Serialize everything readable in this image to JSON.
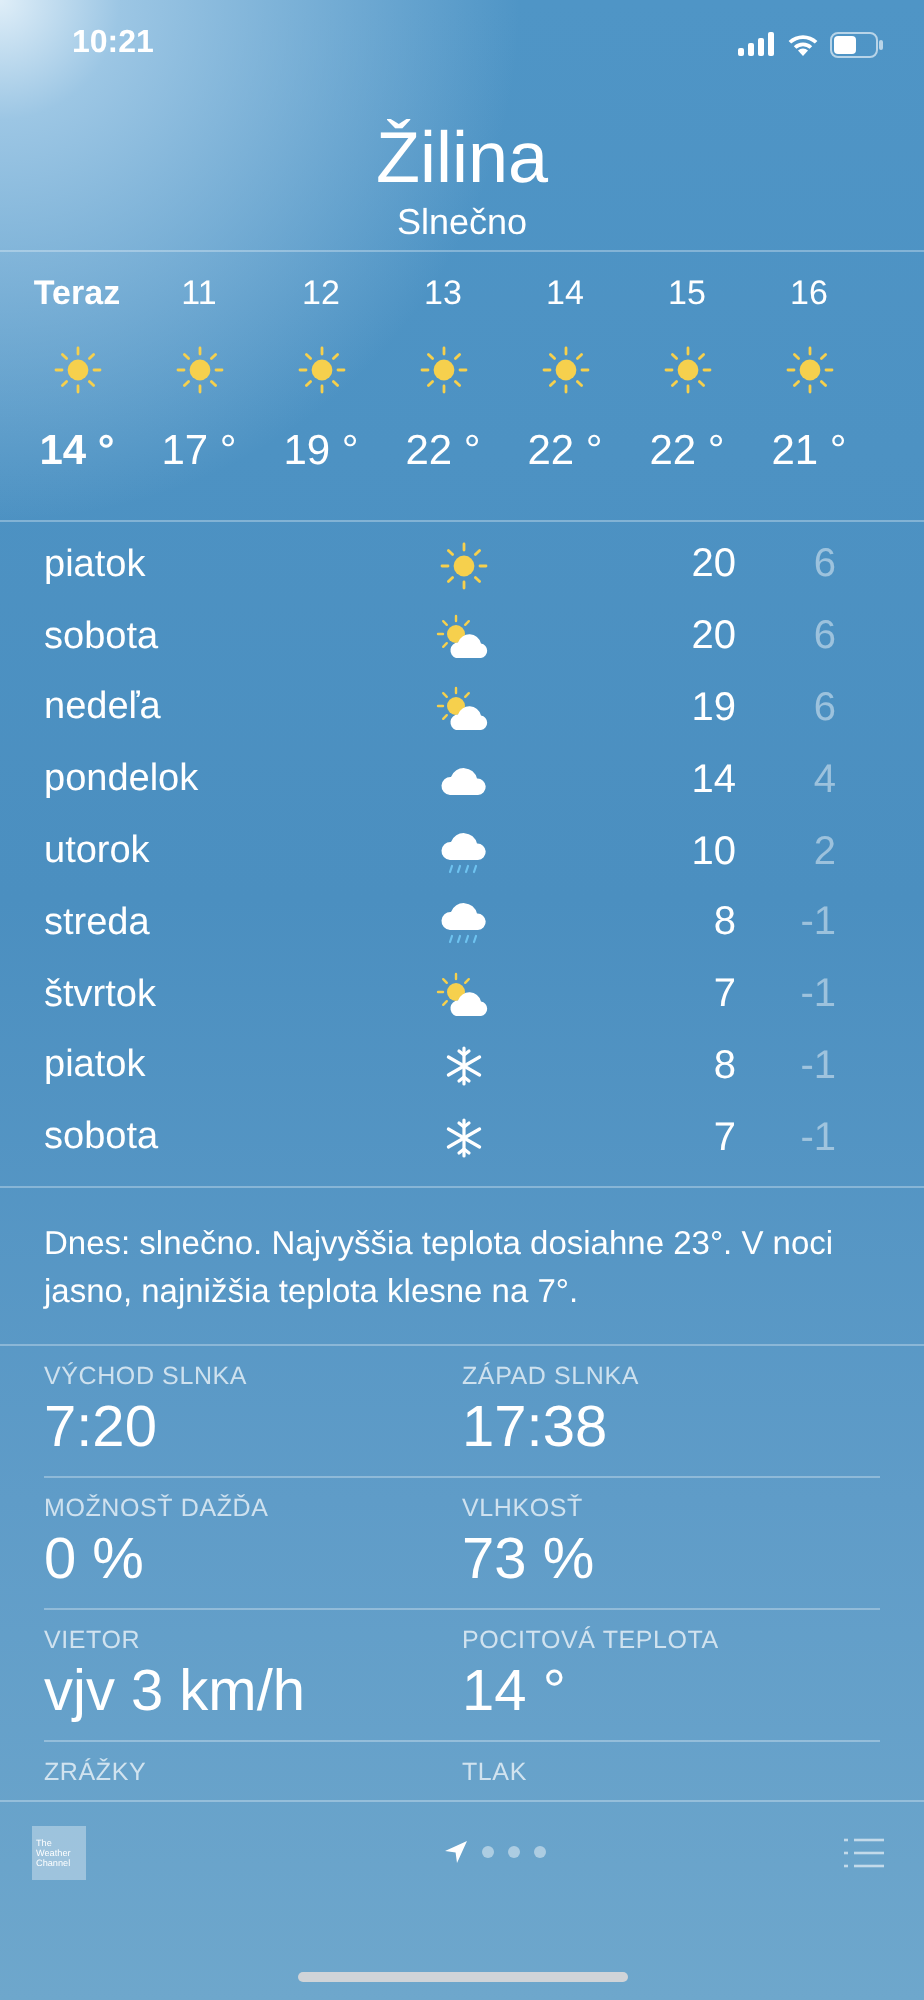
{
  "status_bar": {
    "time": "10:21"
  },
  "header": {
    "city": "Žilina",
    "condition": "Slnečno"
  },
  "hourly": [
    {
      "label": "Teraz",
      "kind": "sun",
      "temp": "14 °",
      "now": true
    },
    {
      "label": "11",
      "kind": "sun",
      "temp": "17 °",
      "now": false
    },
    {
      "label": "12",
      "kind": "sun",
      "temp": "19 °",
      "now": false
    },
    {
      "label": "13",
      "kind": "sun",
      "temp": "22 °",
      "now": false
    },
    {
      "label": "14",
      "kind": "sun",
      "temp": "22 °",
      "now": false
    },
    {
      "label": "15",
      "kind": "sun",
      "temp": "22 °",
      "now": false
    },
    {
      "label": "16",
      "kind": "sun",
      "temp": "21 °",
      "now": false
    }
  ],
  "daily": [
    {
      "day": "piatok",
      "kind": "sun",
      "high": "20",
      "low": "6"
    },
    {
      "day": "sobota",
      "kind": "partly",
      "high": "20",
      "low": "6"
    },
    {
      "day": "nedeľa",
      "kind": "partly",
      "high": "19",
      "low": "6"
    },
    {
      "day": "pondelok",
      "kind": "cloud",
      "high": "14",
      "low": "4"
    },
    {
      "day": "utorok",
      "kind": "rain",
      "high": "10",
      "low": "2"
    },
    {
      "day": "streda",
      "kind": "rain",
      "high": "8",
      "low": "-1"
    },
    {
      "day": "štvrtok",
      "kind": "partly",
      "high": "7",
      "low": "-1"
    },
    {
      "day": "piatok",
      "kind": "snow",
      "high": "8",
      "low": "-1"
    },
    {
      "day": "sobota",
      "kind": "snow",
      "high": "7",
      "low": "-1"
    }
  ],
  "summary": "Dnes: slnečno. Najvyššia teplota dosiahne 23°. V noci jasno, najnižšia teplota klesne na 7°.",
  "details": [
    {
      "label": "VÝCHOD SLNKA",
      "value": "7:20"
    },
    {
      "label": "ZÁPAD SLNKA",
      "value": "17:38"
    },
    {
      "label": "MOŽNOSŤ DAŽĎA",
      "value": "0 %"
    },
    {
      "label": "VLHKOSŤ",
      "value": "73 %"
    },
    {
      "label": "VIETOR",
      "value": "vjv 3 km/h"
    },
    {
      "label": "POCITOVÁ TEPLOTA",
      "value": "14 °"
    },
    {
      "label": "ZRÁŽKY"
    },
    {
      "label": "TLAK"
    }
  ],
  "toolbar": {
    "logo_lines": [
      "The",
      "Weather",
      "Channel"
    ],
    "pages": [
      {
        "kind": "location",
        "selected": true
      },
      {
        "kind": "dot",
        "selected": false
      },
      {
        "kind": "dot",
        "selected": false
      },
      {
        "kind": "dot",
        "selected": false
      }
    ]
  }
}
